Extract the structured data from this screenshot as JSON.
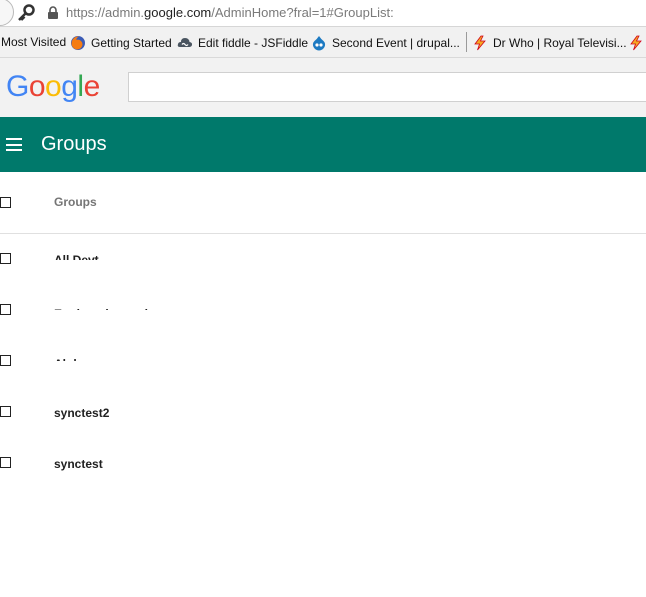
{
  "browser": {
    "url_prefix": "https://admin.",
    "url_domain": "google.com",
    "url_path": "/AdminHome?fral=1#GroupList:"
  },
  "bookmarks": [
    {
      "label": "Most Visited",
      "icon": "none"
    },
    {
      "label": "Getting Started",
      "icon": "firefox-icon"
    },
    {
      "label": "Edit fiddle - JSFiddle",
      "icon": "jsfiddle-icon"
    },
    {
      "label": "Second Event | drupal...",
      "icon": "drupal-icon"
    },
    {
      "label": "Dr Who | Royal Televisi...",
      "icon": "bolt-icon"
    }
  ],
  "header": {
    "logo": [
      "G",
      "o",
      "o",
      "g",
      "l",
      "e"
    ],
    "search_placeholder": ""
  },
  "appbar": {
    "title": "Groups",
    "color": "#00796b"
  },
  "list": {
    "column_header": "Groups",
    "rows": [
      {
        "label": "All Devt"
      },
      {
        "label": "Engineering and more ops"
      },
      {
        "label": "Alpha"
      },
      {
        "label": "synctest2"
      },
      {
        "label": "synctest"
      }
    ]
  }
}
